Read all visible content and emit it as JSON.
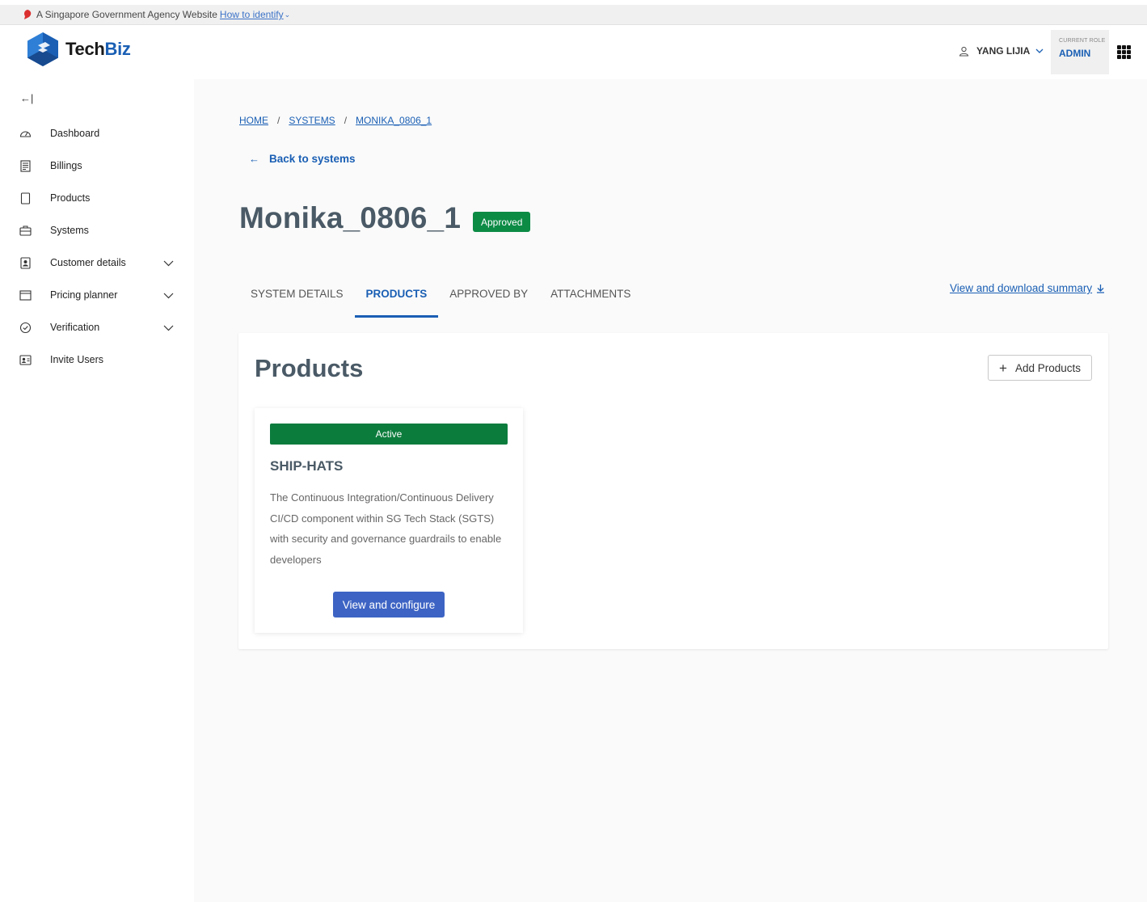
{
  "masthead": {
    "text": "A Singapore Government Agency Website",
    "link": "How to identify"
  },
  "header": {
    "logo_tech": "Tech",
    "logo_biz": "Biz",
    "user_name": "YANG LIJIA",
    "role_label": "CURRENT ROLE",
    "role_value": "ADMIN"
  },
  "sidebar": {
    "items": [
      {
        "label": "Dashboard",
        "icon": "dashboard-icon"
      },
      {
        "label": "Billings",
        "icon": "billing-icon"
      },
      {
        "label": "Products",
        "icon": "products-icon"
      },
      {
        "label": "Systems",
        "icon": "systems-icon"
      },
      {
        "label": "Customer details",
        "icon": "customer-icon"
      },
      {
        "label": "Pricing planner",
        "icon": "pricing-icon"
      },
      {
        "label": "Verification",
        "icon": "verification-icon"
      },
      {
        "label": "Invite Users",
        "icon": "invite-icon"
      }
    ]
  },
  "breadcrumb": {
    "home": "HOME",
    "systems": "SYSTEMS",
    "current": "MONIKA_0806_1"
  },
  "back_link": "Back to systems",
  "page_title": "Monika_0806_1",
  "status_badge": "Approved",
  "tabs": {
    "system_details": "SYSTEM DETAILS",
    "products": "PRODUCTS",
    "approved_by": "APPROVED BY",
    "attachments": "ATTACHMENTS"
  },
  "summary_link": "View and download summary",
  "products_panel": {
    "title": "Products",
    "add_button": "Add Products",
    "card": {
      "status": "Active",
      "name": "SHIP-HATS",
      "description": "The Continuous Integration/Continuous Delivery CI/CD component within SG Tech Stack (SGTS) with security and governance guardrails to enable developers",
      "button": "View and configure"
    }
  },
  "colors": {
    "primary": "#1a5fb4",
    "approved_green": "#0c8b45",
    "active_green": "#0c7c3d",
    "button_blue": "#3d64c4",
    "title_gray": "#4a5a66"
  }
}
